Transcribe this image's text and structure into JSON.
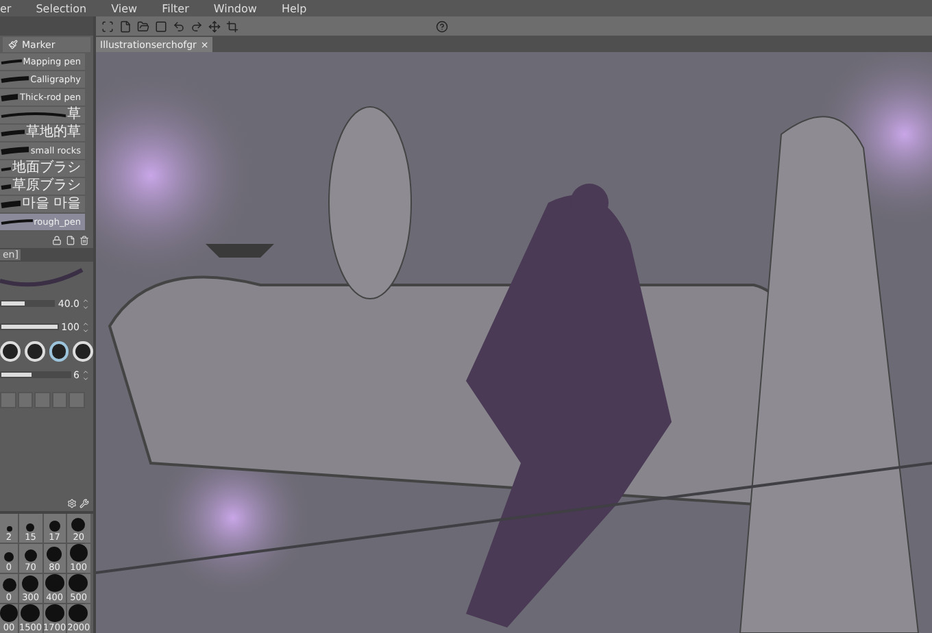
{
  "menu": [
    "er",
    "Selection",
    "View",
    "Filter",
    "Window",
    "Help"
  ],
  "document_tab": {
    "title": "Illustrationserchofgr",
    "close": "×"
  },
  "brush_group": "Marker",
  "brushes": [
    {
      "name": "Mapping pen",
      "selected": false
    },
    {
      "name": "Calligraphy",
      "selected": false
    },
    {
      "name": "Thick-rod pen",
      "selected": false
    },
    {
      "name": "草",
      "selected": false
    },
    {
      "name": "草地的草",
      "selected": false
    },
    {
      "name": "small rocks",
      "selected": false
    },
    {
      "name": "地面ブラシ",
      "selected": false
    },
    {
      "name": "草原ブラシ",
      "selected": false
    },
    {
      "name": "마을 마을",
      "selected": false
    },
    {
      "name": "rough_pen",
      "selected": true
    }
  ],
  "tool_property_tab": "en]",
  "brush_size": {
    "value": "40.0",
    "level": 0.45
  },
  "opacity": {
    "value": "100",
    "level": 1
  },
  "tips": [
    {
      "selected": false
    },
    {
      "selected": false
    },
    {
      "selected": true
    },
    {
      "selected": false
    }
  ],
  "stabilization": {
    "value": "6",
    "level": 0.45
  },
  "sizes": [
    [
      "2",
      "15",
      "17",
      "20"
    ],
    [
      "0",
      "70",
      "80",
      "100"
    ],
    [
      "0",
      "300",
      "400",
      "500"
    ],
    [
      "00",
      "1500",
      "1700",
      "2000"
    ]
  ]
}
